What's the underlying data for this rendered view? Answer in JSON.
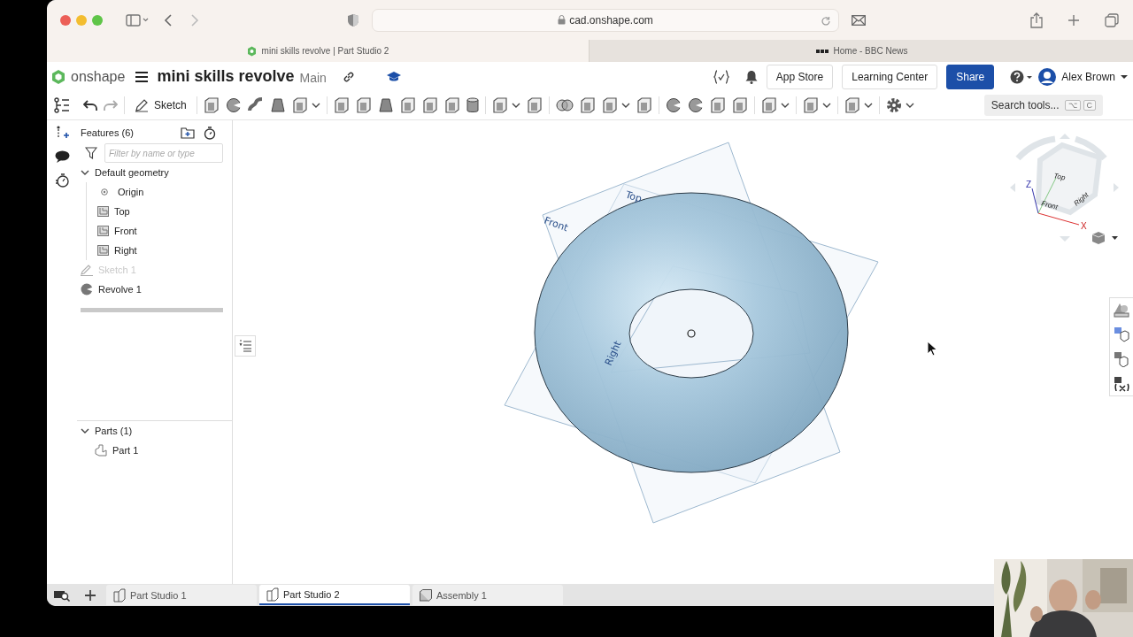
{
  "browser": {
    "url": "cad.onshape.com",
    "tabs": [
      {
        "title": "mini skills revolve | Part Studio 2",
        "selected": true
      },
      {
        "title": "Home - BBC News",
        "selected": false
      }
    ]
  },
  "app": {
    "logo": "onshape",
    "document_title": "mini skills revolve",
    "branch": "Main",
    "buttons": [
      {
        "label": "App Store",
        "kind": "plain"
      },
      {
        "label": "Learning Center",
        "kind": "plain"
      },
      {
        "label": "Share",
        "kind": "primary"
      }
    ],
    "user": "Alex Brown"
  },
  "toolbar": {
    "sketch": "Sketch",
    "search": {
      "placeholder": "Search tools...",
      "keys": [
        "⌥",
        "C"
      ]
    }
  },
  "features": {
    "title": "Features (6)",
    "filter": {
      "placeholder": "Filter by name or type"
    },
    "tree": [
      {
        "label": "Default geometry",
        "kind": "group",
        "expanded": true,
        "children": [
          {
            "label": "Origin",
            "kind": "point",
            "dimmed": false
          },
          {
            "label": "Top",
            "kind": "plane",
            "dimmed": false
          },
          {
            "label": "Front",
            "kind": "plane",
            "dimmed": false
          },
          {
            "label": "Right",
            "kind": "plane",
            "dimmed": false
          }
        ]
      },
      {
        "label": "Sketch 1",
        "kind": "sketch",
        "dimmed": true
      },
      {
        "label": "Revolve 1",
        "kind": "revolve",
        "dimmed": false
      }
    ]
  },
  "parts": {
    "title": "Parts (1)",
    "expanded": true,
    "items": [
      {
        "label": "Part 1"
      }
    ]
  },
  "viewport": {
    "planes": [
      {
        "label": "Top"
      },
      {
        "label": "Front"
      },
      {
        "label": "Right"
      }
    ],
    "view_cube": {
      "faces": [
        "Top",
        "Front",
        "Right"
      ],
      "axes": [
        "Z",
        "X"
      ]
    }
  },
  "bottom_tabs": [
    {
      "label": "Part Studio 1",
      "kind": "part_studio",
      "selected": false
    },
    {
      "label": "Part Studio 2",
      "kind": "part_studio",
      "selected": true
    },
    {
      "label": "Assembly 1",
      "kind": "assembly",
      "selected": false
    }
  ]
}
